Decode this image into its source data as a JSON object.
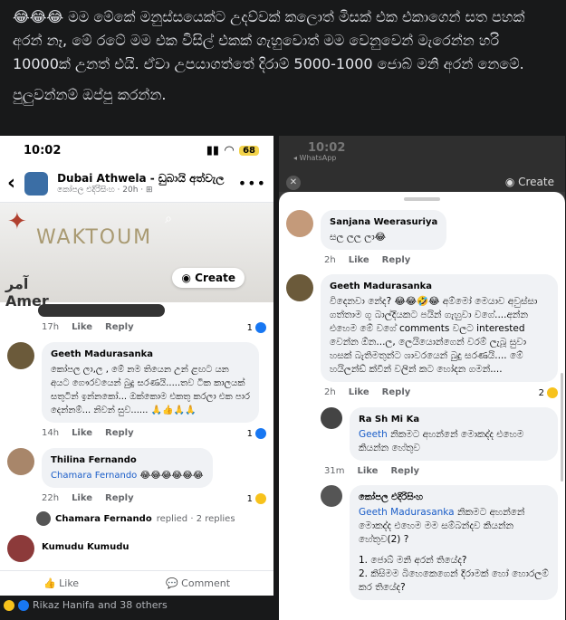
{
  "post": {
    "paragraph1": "😂😂😂 මම මේකේ මනුස්සයෙක්ට උදව්වක් කලොත් මිසක් එක එකාගෙන් සත පහක් අරන් නෑ, මේ රටේ මම එක විසිල් එකක් ගැහුවොත් මම වෙනුවෙන් මැරෙන්න හරි 10000ක් උනත් එයි. ඒවා උපයාගත්තේ දිරාම් 5000-1000 ජොබ් මනි අරන් නෙමේ.",
    "paragraph2": "පුලුවන්නම් ඔප්පු කරන්න."
  },
  "left_screen": {
    "status_time": "10:02",
    "battery": "68",
    "group_title": "Dubai Athwela - ඩුබායි අත්වැල",
    "group_sub": "කෝපල එදිරිසිංහ · 20h · ⊞",
    "banner_logo": "WAKTOUM",
    "banner_arabic": "آمر",
    "banner_amer": "Amer",
    "create_label": "Create",
    "top_meta": {
      "time": "17h",
      "like": "Like",
      "reply": "Reply",
      "count": "1"
    },
    "comments": [
      {
        "name": "Geeth Madurasanka",
        "text": "කෝපල ලා,ල , මේ නම තියෙන උන් ළඟට යන අයට ගෞරවයෙන් බුදු සරණයි.....තව ටික කාලයක් සතුටින් ඉන්නකෝ... ඔක්කොම එකතු කරලා එක පාර දෙන්නම්... නිවන් සුව...... 🙏👍🙏🙏",
        "time": "14h",
        "like": "Like",
        "reply": "Reply",
        "count": "1"
      },
      {
        "name": "Thilina Fernando",
        "mention": "Chamara Fernando",
        "emojis": "😂😂😂😂😂😂",
        "time": "22h",
        "like": "Like",
        "reply": "Reply",
        "count": "1"
      }
    ],
    "replied_line": {
      "name": "Chamara Fernando",
      "text": "replied · 2 replies"
    },
    "last_name": "Kumudu Kumudu",
    "action_like": "Like",
    "action_comment": "Comment",
    "reactions": "Rikaz Hanifa and 38 others"
  },
  "right_screen": {
    "status_time": "10:02",
    "wa_label": "◂ WhatsApp",
    "close_icon": "✕",
    "create_label": "Create",
    "comments": [
      {
        "name": "Sanjana Weerasuriya",
        "text": "සල ලල ලා😂",
        "time": "2h",
        "like": "Like",
        "reply": "Reply"
      },
      {
        "name": "Geeth Madurasanka",
        "text": "විදෙනවා නේද? 😂😂🤣😂 අම්මෝ මෙයාව අවුස්සා ගත්තාම ගූ බාල්දියකට පයින් ගැහුවා වගේ....අන්න එහෙම මේ වගේ comments වලට interested වෙන්න ඕන...ල, ලෙයියොන්ගෙන් වරම් ලැබූ සුවා හසක් බැතිමතුන්ට ශාවරයෙන් බුදු සරණයි.... මේ හයිලන්ඩ් ක්වීන් වලින් කට හෝදන ගමන්....",
        "time": "2h",
        "like": "Like",
        "reply": "Reply",
        "count": "2"
      }
    ],
    "replies": [
      {
        "name": "Ra Sh Mi Ka",
        "mention": "Geeth",
        "text": "නිකමට අහන්නේ මොකද්ද එහෙම කියන්න හේතුව",
        "time": "31m",
        "like": "Like",
        "reply": "Reply"
      },
      {
        "name": "කෝපල එදිරිසිංහ",
        "mention": "Geeth Madurasanka",
        "text": "නිකමට අහන්නේ මොකද්ද එහෙම මම සම්බන්දව කියන්න හේතුව(2) ?",
        "list1": "1. ජොබ් මනි අරන් තියේද?",
        "list2": "2. කිසිමම බිහෙකෙගෙන් දිරාමක් හෝ හොරලම් කර තියේද?"
      }
    ]
  }
}
